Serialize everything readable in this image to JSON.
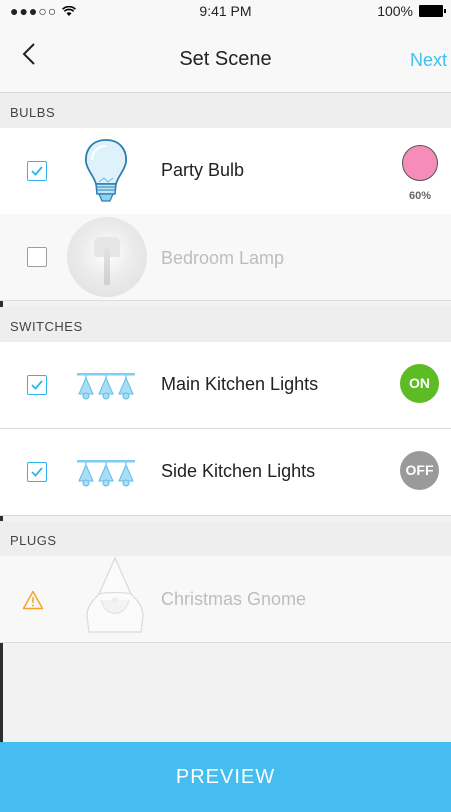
{
  "status_bar": {
    "signal": "●●●○○",
    "time": "9:41 PM",
    "battery": "100%"
  },
  "nav": {
    "title": "Set Scene",
    "next_label": "Next"
  },
  "sections": {
    "bulbs": "BULBS",
    "switches": "SWITCHES",
    "plugs": "PLUGS"
  },
  "bulbs": [
    {
      "label": "Party Bulb",
      "checked": true,
      "color": "#f58cb9",
      "brightness": "60%"
    },
    {
      "label": "Bedroom Lamp",
      "checked": false
    }
  ],
  "switches": [
    {
      "label": "Main Kitchen Lights",
      "checked": true,
      "state": "ON"
    },
    {
      "label": "Side Kitchen Lights",
      "checked": true,
      "state": "OFF"
    }
  ],
  "plugs": [
    {
      "label": "Christmas Gnome",
      "warning": true
    }
  ],
  "preview_label": "PREVIEW",
  "colors": {
    "accent": "#3dc1ef",
    "on": "#5dbb23",
    "off": "#9a9a9a",
    "warning": "#f5a623"
  }
}
